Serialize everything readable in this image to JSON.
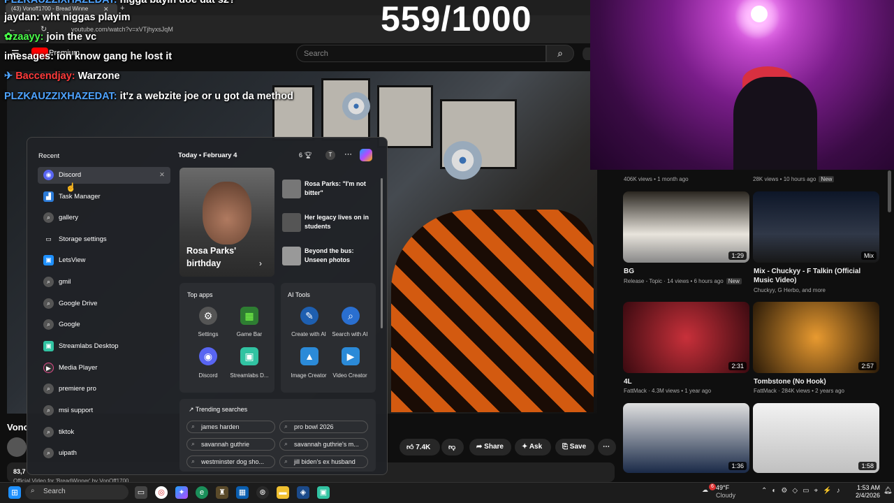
{
  "overlay": {
    "counter": "559/1000"
  },
  "chat": [
    {
      "user": "PLZKAUZZIXHAZEDAT:",
      "msg": "nigga bayin doe dat s2?",
      "color": "#4ea3ff"
    },
    {
      "user": "jaydan:",
      "msg": "wht niggas playim",
      "color": "#ffffff"
    },
    {
      "user": "zaayy:",
      "msg": "join the vc",
      "color": "#4aff4a"
    },
    {
      "user": "imesages:",
      "msg": "ion know gang he lost it",
      "color": "#ffffff"
    },
    {
      "user": "Baccendjay:",
      "msg": "Warzone",
      "color": "#ff3b3b"
    },
    {
      "user": "PLZKAUZZIXHAZEDAT:",
      "msg": "it'z a webzite joe or u got da method",
      "color": "#4ea3ff"
    }
  ],
  "browser": {
    "tab_title": "(43) Vonoff1700 - Bread Winne",
    "url": "youtube.com/watch?v=xVTjhyxsJqM",
    "brand": "Premium",
    "search_placeholder": "Search"
  },
  "video": {
    "title_partial": "Vonc",
    "views_partial": "83,7",
    "desc_partial": "Official Video for 'BreadWinner' by VonOff1700"
  },
  "actions": {
    "likes": "7.4K",
    "share": "Share",
    "ask": "Ask",
    "save": "Save"
  },
  "recs": [
    {
      "title": "BG",
      "channel": "Release - Topic",
      "meta": "14 views • 6 hours ago",
      "badge": "New",
      "duration": "1:29",
      "topmeta": "406K views • 1 month ago"
    },
    {
      "title": "Mix - Chuckyy - F Talkin (Official Music Video)",
      "channel": "Chuckyy, G Herbo, and more",
      "meta": "",
      "badge": "",
      "duration": "Mix",
      "topmeta": "28K views • 10 hours ago"
    },
    {
      "title": "4L",
      "channel": "FattMack",
      "meta": "4.3M views • 1 year ago",
      "badge": "",
      "duration": "2:31"
    },
    {
      "title": "Tombstone (No Hook)",
      "channel": "FattMack",
      "meta": "284K views • 2 years ago",
      "badge": "",
      "duration": "2:57"
    },
    {
      "title": "",
      "channel": "",
      "meta": "",
      "badge": "",
      "duration": "1:36"
    },
    {
      "title": "",
      "channel": "",
      "meta": "",
      "badge": "",
      "duration": "1:58"
    }
  ],
  "startmenu": {
    "recent_label": "Recent",
    "recent": [
      "Discord",
      "Task Manager",
      "gallery",
      "Storage settings",
      "LetsView",
      "gmil",
      "Google Drive",
      "Google",
      "Streamlabs Desktop",
      "Media Player",
      "premiere pro",
      "msi support",
      "tiktok",
      "uipath"
    ],
    "today": "Today",
    "date": "February 4",
    "points": "6",
    "avatar": "T",
    "hero": "Rosa Parks' birthday",
    "news": [
      "Rosa Parks: \"I'm not bitter\"",
      "Her legacy lives on in students",
      "Beyond the bus: Unseen photos"
    ],
    "top_apps_label": "Top apps",
    "top_apps": [
      "Settings",
      "Game Bar",
      "Discord",
      "Streamlabs D..."
    ],
    "ai_label": "AI Tools",
    "ai_tools": [
      "Create with AI",
      "Search with AI",
      "Image Creator",
      "Video Creator"
    ],
    "trending_label": "Trending searches",
    "trending": [
      "james harden",
      "pro bowl 2026",
      "savannah guthrie",
      "savannah guthrie's m...",
      "westminster dog sho...",
      "jill biden's ex husband"
    ]
  },
  "taskbar": {
    "search": "Search",
    "temp": "49°F",
    "weather": "Cloudy",
    "time": "1:53 AM",
    "date": "2/4/2026",
    "notif": "6"
  },
  "colors": {
    "accent": "#0078d4",
    "yt_red": "#ff0000"
  }
}
